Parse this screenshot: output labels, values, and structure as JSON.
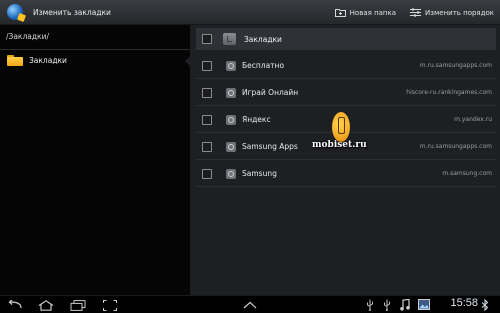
{
  "topbar": {
    "title": "Изменить закладки",
    "new_folder_label": "Новая папка",
    "reorder_label": "Изменить порядок"
  },
  "left_pane": {
    "path": "/Закладки/",
    "folder_label": "Закладки"
  },
  "right_pane": {
    "header_label": "Закладки",
    "bookmarks": [
      {
        "title": "Бесплатно",
        "url": "m.ru.samsungapps.com"
      },
      {
        "title": "Играй Онлайн",
        "url": "hiscore-ru.rankingames.com"
      },
      {
        "title": "Яндекс",
        "url": "m.yandex.ru"
      },
      {
        "title": "Samsung Apps",
        "url": "m.ru.samsungapps.com"
      },
      {
        "title": "Samsung",
        "url": "m.samsung.com"
      }
    ]
  },
  "watermark": "mobiset.ru",
  "status_bar": {
    "time": "15:58"
  },
  "icons": [
    "browser-icon",
    "new-folder-icon",
    "reorder-icon",
    "folder-icon",
    "back-icon",
    "home-icon",
    "recent-apps-icon",
    "screenshot-icon",
    "up-arrow-icon",
    "usb-icon",
    "music-icon",
    "image-icon",
    "bluetooth-icon"
  ]
}
